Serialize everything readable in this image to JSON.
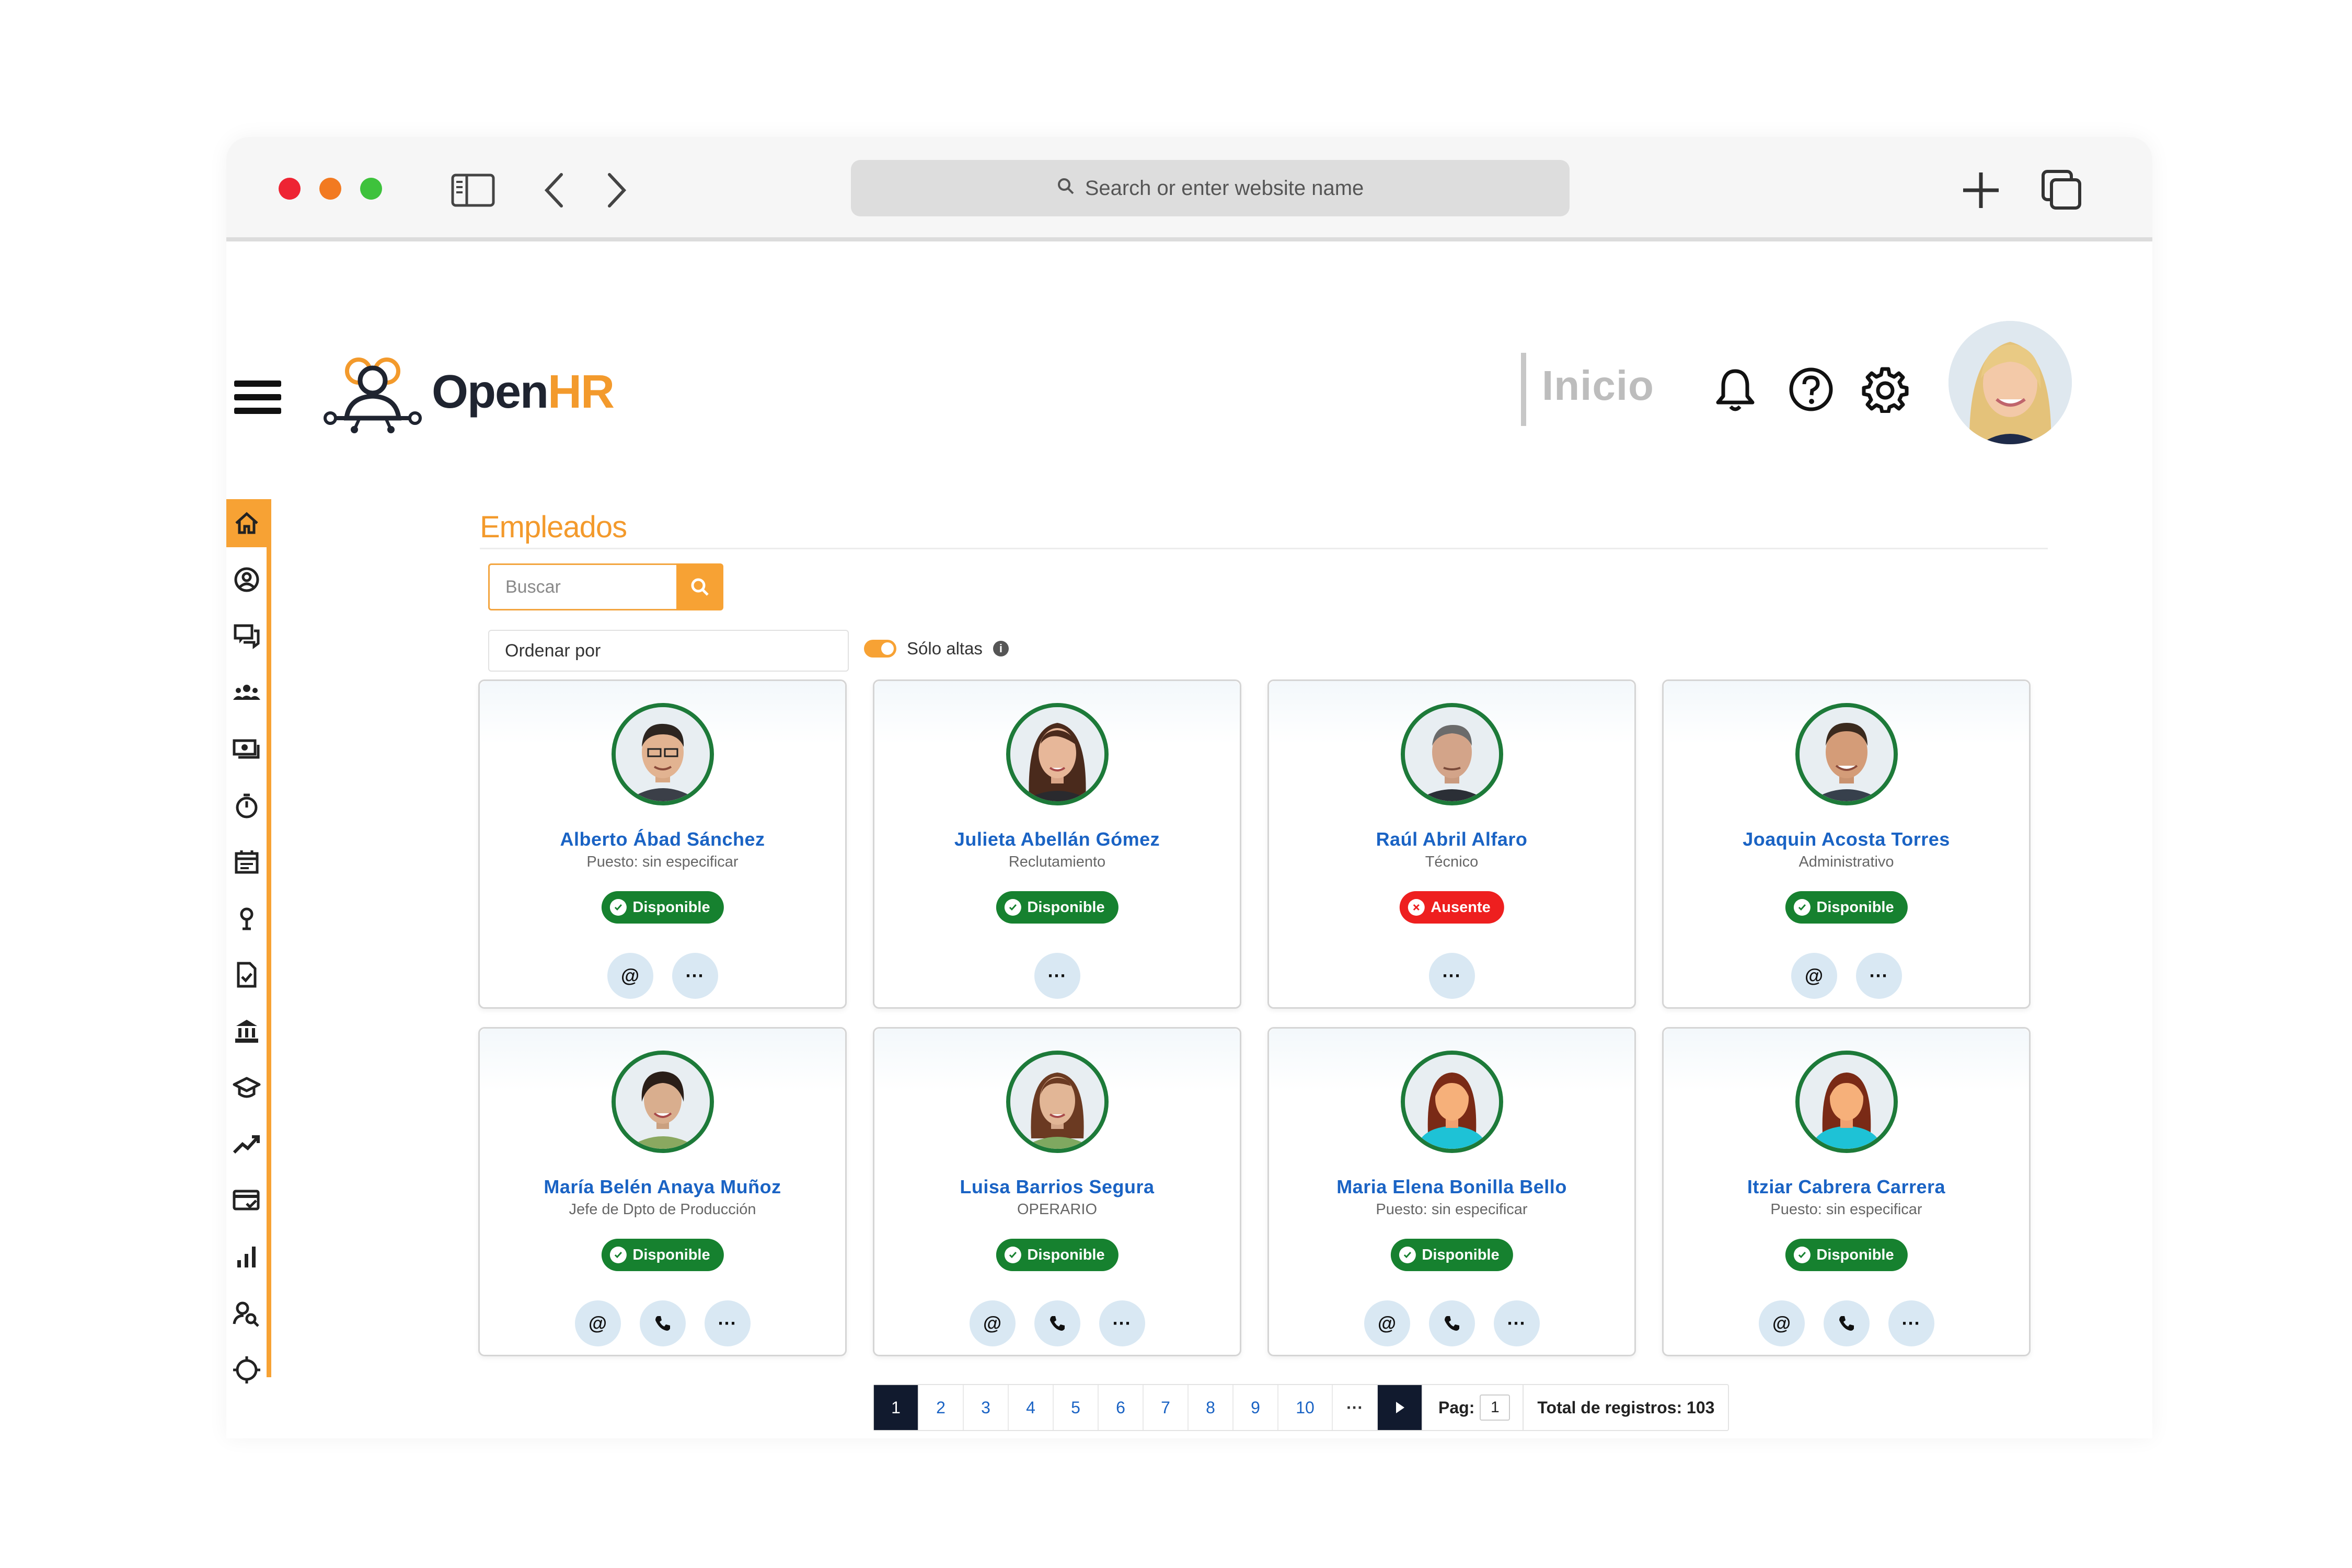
{
  "browser": {
    "address_placeholder": "Search or enter website name"
  },
  "app": {
    "logo_prefix": "Open",
    "logo_suffix": "HR",
    "nav_current": "Inicio"
  },
  "sidebar": {
    "items": [
      "home-icon",
      "user-circle-icon",
      "chat-icon",
      "team-icon",
      "payroll-icon",
      "timer-icon",
      "calendar-icon",
      "location-icon",
      "document-check-icon",
      "bank-icon",
      "graduation-icon",
      "trend-icon",
      "card-check-icon",
      "bar-chart-icon",
      "user-search-icon",
      "target-icon"
    ]
  },
  "main": {
    "title": "Empleados",
    "search_placeholder": "Buscar",
    "sort_label": "Ordenar por",
    "only_active_label": "Sólo altas",
    "only_active_on": true
  },
  "employees": [
    {
      "name": "Alberto Ábad Sánchez",
      "role": "Puesto: sin especificar",
      "status": "Disponible",
      "status_type": "ok",
      "actions": [
        "@",
        "···"
      ]
    },
    {
      "name": "Julieta Abellán Gómez",
      "role": "Reclutamiento",
      "status": "Disponible",
      "status_type": "ok",
      "actions": [
        "···"
      ]
    },
    {
      "name": "Raúl Abril Alfaro",
      "role": "Técnico",
      "status": "Ausente",
      "status_type": "bad",
      "actions": [
        "···"
      ]
    },
    {
      "name": "Joaquin Acosta Torres",
      "role": "Administrativo",
      "status": "Disponible",
      "status_type": "ok",
      "actions": [
        "@",
        "···"
      ]
    },
    {
      "name": "María Belén Anaya Muñoz",
      "role": "Jefe de Dpto de Producción",
      "status": "Disponible",
      "status_type": "ok",
      "actions": [
        "@",
        "phone",
        "···"
      ]
    },
    {
      "name": "Luisa Barrios Segura",
      "role": "OPERARIO",
      "status": "Disponible",
      "status_type": "ok",
      "actions": [
        "@",
        "phone",
        "···"
      ]
    },
    {
      "name": "Maria Elena Bonilla Bello",
      "role": "Puesto: sin especificar",
      "status": "Disponible",
      "status_type": "ok",
      "actions": [
        "@",
        "phone",
        "···"
      ]
    },
    {
      "name": "Itziar Cabrera Carrera",
      "role": "Puesto: sin especificar",
      "status": "Disponible",
      "status_type": "ok",
      "actions": [
        "@",
        "phone",
        "···"
      ]
    }
  ],
  "pagination": {
    "pages": [
      "1",
      "2",
      "3",
      "4",
      "5",
      "6",
      "7",
      "8",
      "9",
      "10"
    ],
    "current": "1",
    "ellipsis": "···",
    "page_label": "Pag:",
    "page_value": "1",
    "total_label": "Total de registros: 103"
  },
  "colors": {
    "accent": "#f7a234",
    "link": "#1a63c4",
    "available": "#16812f",
    "absent": "#ee1f1f"
  }
}
